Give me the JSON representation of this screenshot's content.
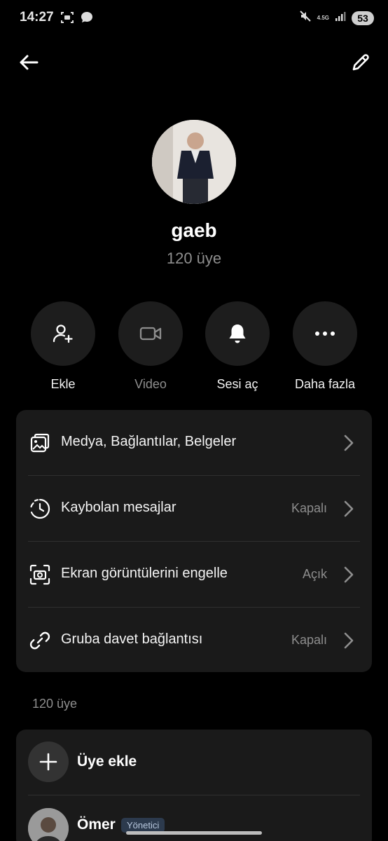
{
  "status_bar": {
    "time": "14:27",
    "network": "4.5G",
    "battery": "53"
  },
  "header": {
    "back_icon": "arrow-left-icon",
    "edit_icon": "pencil-icon"
  },
  "profile": {
    "name": "gaeb",
    "member_count": "120 üye"
  },
  "actions": [
    {
      "label": "Ekle",
      "icon": "add-person-icon"
    },
    {
      "label": "Video",
      "icon": "video-camera-icon"
    },
    {
      "label": "Sesi aç",
      "icon": "bell-icon"
    },
    {
      "label": "Daha fazla",
      "icon": "more-dots-icon"
    }
  ],
  "settings": [
    {
      "label": "Medya, Bağlantılar, Belgeler",
      "value": "",
      "icon": "media-gallery-icon"
    },
    {
      "label": "Kaybolan mesajlar",
      "value": "Kapalı",
      "icon": "timer-icon"
    },
    {
      "label": "Ekran görüntülerini engelle",
      "value": "Açık",
      "icon": "screenshot-block-icon"
    },
    {
      "label": "Gruba davet bağlantısı",
      "value": "Kapalı",
      "icon": "link-icon"
    }
  ],
  "members_section": {
    "title": "120 üye",
    "add_member_label": "Üye ekle",
    "first_member_name": "Ömer",
    "first_member_badge": "Yönetici"
  }
}
